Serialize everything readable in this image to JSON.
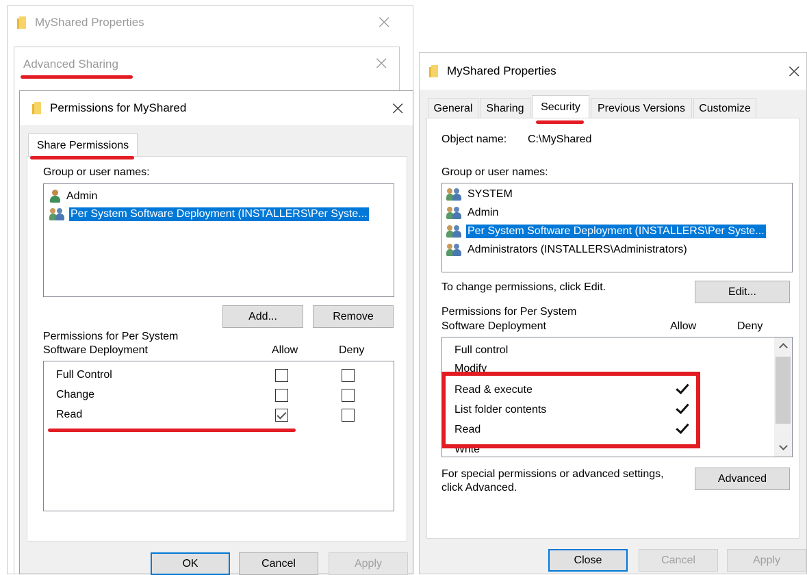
{
  "back_window": {
    "title": "MyShared Properties"
  },
  "advanced_sharing": {
    "title": "Advanced Sharing"
  },
  "permissions_dialog": {
    "title": "Permissions for MyShared",
    "tab": "Share Permissions",
    "group_label": "Group or user names:",
    "users": [
      {
        "name": "Admin",
        "icon": "user-icon",
        "selected": false
      },
      {
        "name": "Per System Software Deployment (INSTALLERS\\Per Syste...",
        "icon": "group-icon",
        "selected": true
      }
    ],
    "add_label": "Add...",
    "remove_label": "Remove",
    "perm_label_line1": "Permissions for Per System",
    "perm_label_line2": "Software Deployment",
    "allow_label": "Allow",
    "deny_label": "Deny",
    "permissions": [
      {
        "name": "Full Control",
        "allow": false,
        "deny": false
      },
      {
        "name": "Change",
        "allow": false,
        "deny": false
      },
      {
        "name": "Read",
        "allow": true,
        "deny": false
      }
    ],
    "ok_label": "OK",
    "cancel_label": "Cancel",
    "apply_label": "Apply"
  },
  "security_window": {
    "title": "MyShared Properties",
    "tabs": [
      "General",
      "Sharing",
      "Security",
      "Previous Versions",
      "Customize"
    ],
    "active_tab": "Security",
    "object_name_label": "Object name:",
    "object_name_value": "C:\\MyShared",
    "group_label": "Group or user names:",
    "users": [
      {
        "name": "SYSTEM",
        "icon": "group-icon",
        "selected": false
      },
      {
        "name": "Admin",
        "icon": "group-icon",
        "selected": false
      },
      {
        "name": "Per System Software Deployment (INSTALLERS\\Per Syste...",
        "icon": "group-icon",
        "selected": true
      },
      {
        "name": "Administrators (INSTALLERS\\Administrators)",
        "icon": "group-icon",
        "selected": false
      }
    ],
    "change_label": "To change permissions, click Edit.",
    "edit_label": "Edit...",
    "perm_label_line1": "Permissions for Per System",
    "perm_label_line2": "Software Deployment",
    "allow_label": "Allow",
    "deny_label": "Deny",
    "permissions": [
      {
        "name": "Full control",
        "allow": false
      },
      {
        "name": "Modify",
        "allow": false
      },
      {
        "name": "Read & execute",
        "allow": true
      },
      {
        "name": "List folder contents",
        "allow": true
      },
      {
        "name": "Read",
        "allow": true
      },
      {
        "name": "Write",
        "allow": false
      }
    ],
    "special_line1": "For special permissions or advanced settings,",
    "special_line2": "click Advanced.",
    "advanced_label": "Advanced",
    "close_label": "Close",
    "cancel_label": "Cancel",
    "apply_label": "Apply"
  },
  "colors": {
    "highlight": "#e31b23",
    "selection": "#0078d7"
  }
}
